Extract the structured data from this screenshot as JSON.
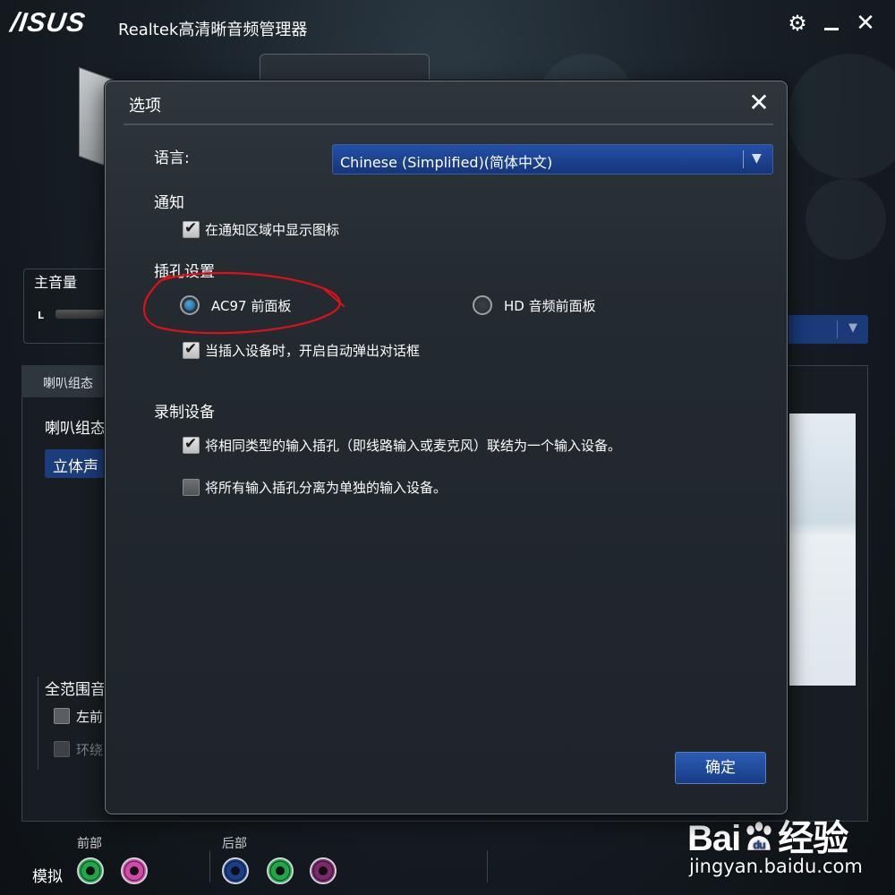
{
  "app": {
    "logo": "/ISUS",
    "title": "Realtek高清晰音频管理器"
  },
  "background": {
    "main_volume_label": "主音量",
    "main_volume_channel": "L",
    "tab_label": "喇叭组态",
    "speaker_config_label": "喇叭组态",
    "stereo_button": "立体声",
    "full_range_label": "全范围音",
    "front_checkbox_label": "左前",
    "surround_checkbox_label": "环绕"
  },
  "footer": {
    "front_label": "前部",
    "rear_label": "后部",
    "analog_label": "模拟",
    "jacks": [
      {
        "name": "front-green",
        "color": "#1fa64a"
      },
      {
        "name": "front-pink",
        "color": "#d04aa8"
      },
      {
        "name": "rear-blue",
        "color": "#1b3e8a"
      },
      {
        "name": "rear-green",
        "color": "#1fa64a"
      },
      {
        "name": "rear-purple",
        "color": "#7a2a6a"
      }
    ]
  },
  "dialog": {
    "title": "选项",
    "language_label": "语言:",
    "language_value": "Chinese (Simplified)(简体中文)",
    "notification_section": "通知",
    "notification_checkbox": {
      "label": "在通知区域中显示图标",
      "checked": true
    },
    "jack_section": "插孔设置",
    "radio_ac97": {
      "label": "AC97 前面板",
      "selected": true
    },
    "radio_hd": {
      "label": "HD 音频前面板",
      "selected": false
    },
    "auto_popup_checkbox": {
      "label": "当插入设备时，开启自动弹出对话框",
      "checked": true
    },
    "recording_section": "录制设备",
    "combine_inputs_checkbox": {
      "label": "将相同类型的输入插孔（即线路输入或麦克风）联结为一个输入设备。",
      "checked": true
    },
    "separate_inputs_checkbox": {
      "label": "将所有输入插孔分离为单独的输入设备。",
      "checked": false
    },
    "ok_button": "确定"
  },
  "watermark": {
    "logo_text_left": "Bai",
    "logo_text_right": "经验",
    "url": "jingyan.baidu.com"
  },
  "colors": {
    "accent_blue": "#1d3c7c",
    "annotation_red": "#e0101a"
  }
}
